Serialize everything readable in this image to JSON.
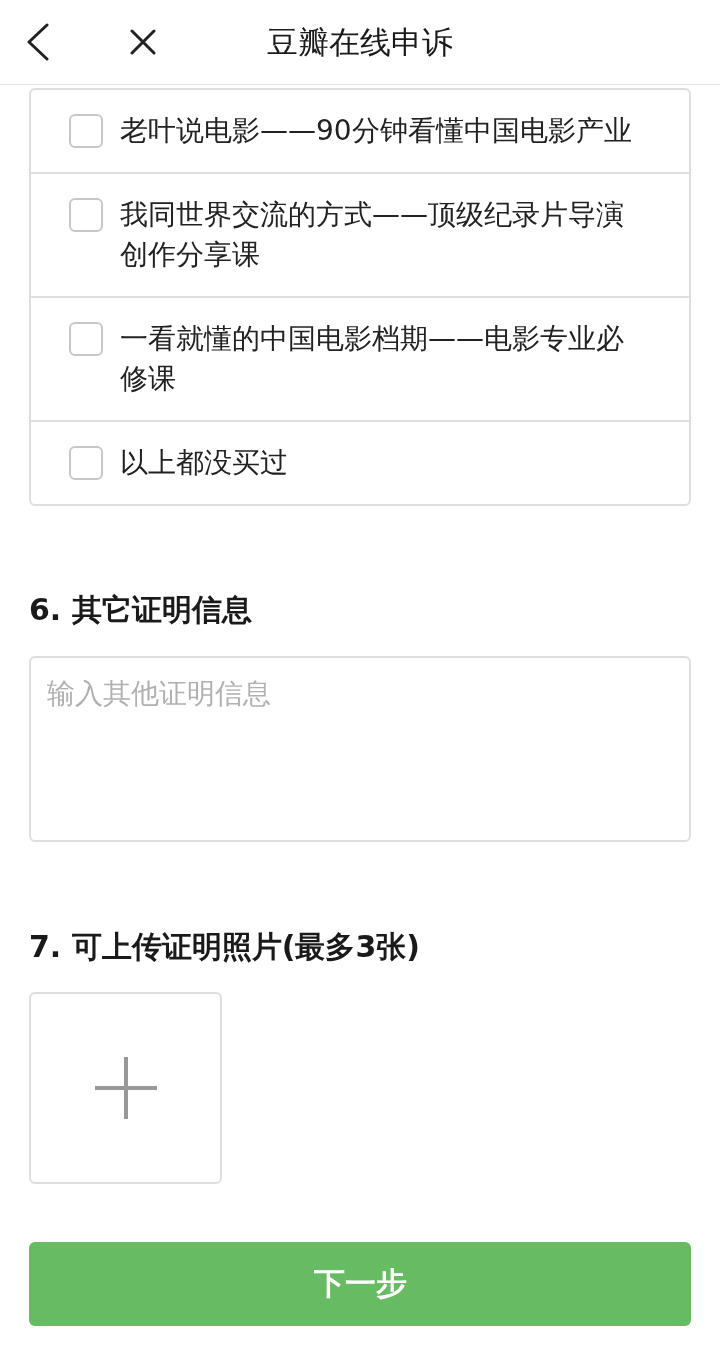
{
  "header": {
    "title": "豆瓣在线申诉"
  },
  "options": [
    {
      "label": "老叶说电影——90分钟看懂中国电影产业",
      "checked": false
    },
    {
      "label": "我同世界交流的方式——顶级纪录片导演创作分享课",
      "checked": false
    },
    {
      "label": "一看就懂的中国电影档期——电影专业必修课",
      "checked": false
    },
    {
      "label": "以上都没买过",
      "checked": false
    }
  ],
  "other_info": {
    "heading": "6. 其它证明信息",
    "placeholder": "输入其他证明信息"
  },
  "photos": {
    "heading": "7. 可上传证明照片(最多3张)"
  },
  "next_button": {
    "label": "下一步"
  }
}
